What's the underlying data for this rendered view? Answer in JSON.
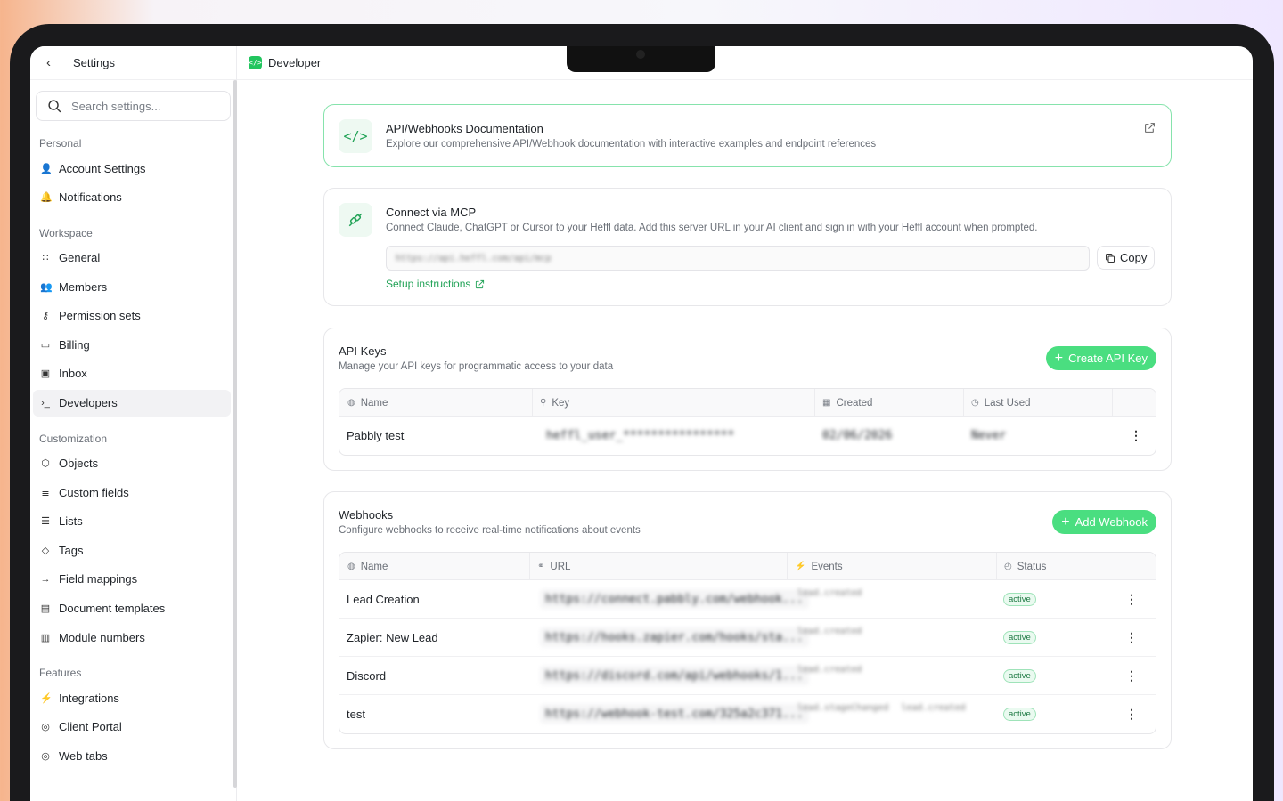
{
  "sidebar": {
    "back_icon": "chevron-left-icon",
    "title": "Settings",
    "search_placeholder": "Search settings...",
    "groups": [
      {
        "title": "Personal",
        "items": [
          {
            "label": "Account Settings",
            "icon": "user-icon"
          },
          {
            "label": "Notifications",
            "icon": "bell-icon"
          }
        ]
      },
      {
        "title": "Workspace",
        "items": [
          {
            "label": "General",
            "icon": "grid-icon"
          },
          {
            "label": "Members",
            "icon": "users-icon"
          },
          {
            "label": "Permission sets",
            "icon": "key-icon"
          },
          {
            "label": "Billing",
            "icon": "credit-card-icon"
          },
          {
            "label": "Inbox",
            "icon": "inbox-icon"
          },
          {
            "label": "Developers",
            "icon": "terminal-icon",
            "active": true
          }
        ]
      },
      {
        "title": "Customization",
        "items": [
          {
            "label": "Objects",
            "icon": "cube-icon"
          },
          {
            "label": "Custom fields",
            "icon": "fields-icon"
          },
          {
            "label": "Lists",
            "icon": "list-icon"
          },
          {
            "label": "Tags",
            "icon": "tag-icon"
          },
          {
            "label": "Field mappings",
            "icon": "arrow-right-icon"
          },
          {
            "label": "Document templates",
            "icon": "document-icon"
          },
          {
            "label": "Module numbers",
            "icon": "file-number-icon"
          }
        ]
      },
      {
        "title": "Features",
        "items": [
          {
            "label": "Integrations",
            "icon": "plug-icon"
          },
          {
            "label": "Client Portal",
            "icon": "globe-icon"
          },
          {
            "label": "Web tabs",
            "icon": "globe-icon"
          }
        ]
      }
    ]
  },
  "topbar": {
    "title": "Developer"
  },
  "docs": {
    "title": "API/Webhooks Documentation",
    "subtitle": "Explore our comprehensive API/Webhook documentation with interactive examples and endpoint references"
  },
  "mcp": {
    "title": "Connect via MCP",
    "subtitle": "Connect Claude, ChatGPT or Cursor to your Heffl data. Add this server URL in your AI client and sign in with your Heffl account when prompted.",
    "url_value": "https://api.heffl.com/api/mcp",
    "copy_label": "Copy",
    "setup_label": "Setup instructions"
  },
  "api_keys": {
    "title": "API Keys",
    "subtitle": "Manage your API keys for programmatic access to your data",
    "create_label": "Create API Key",
    "columns": [
      "Name",
      "Key",
      "Created",
      "Last Used"
    ],
    "rows": [
      {
        "name": "Pabbly test",
        "key": "heffl_user_****************",
        "created": "02/06/2026",
        "last_used": "Never"
      }
    ]
  },
  "webhooks": {
    "title": "Webhooks",
    "subtitle": "Configure webhooks to receive real-time notifications about events",
    "add_label": "Add Webhook",
    "columns": [
      "Name",
      "URL",
      "Events",
      "Status"
    ],
    "rows": [
      {
        "name": "Lead Creation",
        "url": "https://connect.pabbly.com/webhook...",
        "events": [
          "lead.created"
        ],
        "status": "active"
      },
      {
        "name": "Zapier: New Lead",
        "url": "https://hooks.zapier.com/hooks/sta...",
        "events": [
          "lead.created"
        ],
        "status": "active"
      },
      {
        "name": "Discord",
        "url": "https://discord.com/api/webhooks/1...",
        "events": [
          "lead.created"
        ],
        "status": "active"
      },
      {
        "name": "test",
        "url": "https://webhook-test.com/325a2c371...",
        "events": [
          "lead.stageChanged",
          "lead.created"
        ],
        "status": "active"
      }
    ]
  },
  "colors": {
    "accent": "#22c55e",
    "button": "#4ade80",
    "card_border_highlight": "#86e3ac"
  }
}
